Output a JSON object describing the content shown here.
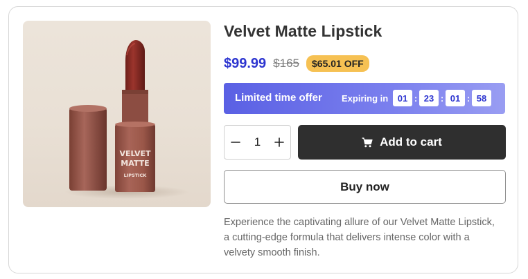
{
  "product": {
    "image_icon": "lipstick-product-photo",
    "image_label_line1": "VELVET",
    "image_label_line2": "MATTE",
    "image_label_line3": "LIPSTICK",
    "title": "Velvet Matte Lipstick",
    "price": "$99.99",
    "old_price": "$165",
    "discount": "$65.01 OFF",
    "description": "Experience the captivating allure of our Velvet Matte Lipstick, a cutting-edge formula that delivers intense color with a velvety smooth finish."
  },
  "offer": {
    "title": "Limited time offer",
    "expiring_label": "Expiring in",
    "countdown": [
      "01",
      "23",
      "01",
      "58"
    ],
    "separator": ":"
  },
  "cart": {
    "quantity": "1",
    "decrement_icon": "minus-icon",
    "increment_icon": "plus-icon",
    "add_to_cart_label": "Add to cart",
    "add_to_cart_icon": "cart-icon",
    "buy_now_label": "Buy now"
  },
  "colors": {
    "price": "#2d35d0",
    "badge": "#f6c153",
    "offer_gradient_start": "#5a60e4",
    "offer_gradient_end": "#999df2",
    "cart_button": "#2f2f2f",
    "lipstick_bullet": "#8e2e27",
    "lipstick_tube": "#9c5b4f"
  }
}
